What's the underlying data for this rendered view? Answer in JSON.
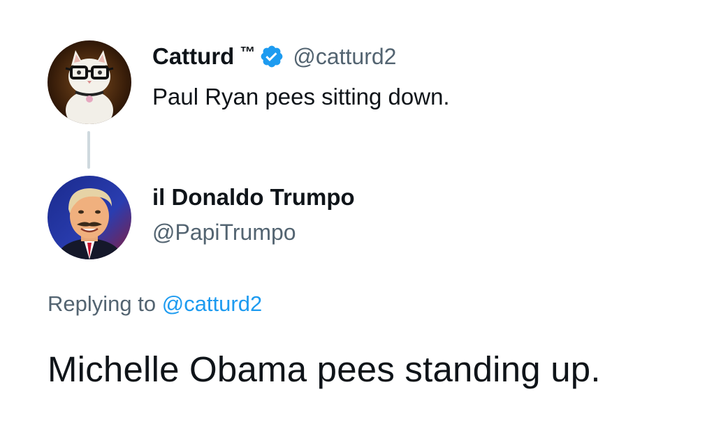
{
  "colors": {
    "text_primary": "#0f1419",
    "text_secondary": "#536471",
    "link": "#1d9bf0",
    "verified_badge": "#1d9bf0",
    "thread_line": "#cfd9de",
    "background": "#ffffff"
  },
  "quoted_tweet": {
    "display_name": "Catturd",
    "trademark": "™",
    "verified_icon": "verified-badge-icon",
    "handle": "@catturd2",
    "text": "Paul Ryan pees sitting down.",
    "avatar_icon": "cat-with-glasses-avatar"
  },
  "reply_tweet": {
    "display_name": "il Donaldo Trumpo",
    "handle": "@PapiTrumpo",
    "avatar_icon": "person-avatar",
    "replying_prefix": "Replying to",
    "replying_to": "@catturd2",
    "text": "Michelle Obama pees standing up."
  }
}
